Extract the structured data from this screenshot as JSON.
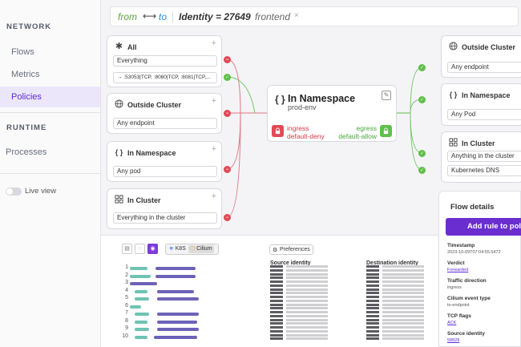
{
  "sidebar": {
    "network_label": "NETWORK",
    "items_network": [
      {
        "label": "Flows"
      },
      {
        "label": "Metrics"
      },
      {
        "label": "Policies"
      }
    ],
    "runtime_label": "RUNTIME",
    "items_runtime": [
      {
        "label": "Processes"
      }
    ],
    "live_view_label": "Live view",
    "live_view_on": false
  },
  "search": {
    "from": "from",
    "arrow": "⟷",
    "to": "to",
    "identity": "Identity = 27649",
    "label": "frontend",
    "close": "×"
  },
  "left_cards": [
    {
      "title": "All",
      "icon": "asterisk-icon",
      "pills": [
        "Everything",
        "→ :53053|TCP, :8080|TCP, :8081|TCP,..."
      ]
    },
    {
      "title": "Outside Cluster",
      "icon": "globe-icon",
      "pills": [
        "Any endpoint"
      ]
    },
    {
      "title": "In Namespace",
      "icon": "braces-icon",
      "pills": [
        "Any pod"
      ]
    },
    {
      "title": "In Cluster",
      "icon": "cluster-icon",
      "pills": [
        "Everything in the cluster"
      ]
    }
  ],
  "center": {
    "braces": "{ }",
    "title": "In Namespace",
    "subtitle": "prod-env",
    "ingress_line1": "ingress",
    "ingress_line2": "default-deny",
    "egress_line1": "egress",
    "egress_line2": "default-allow"
  },
  "right_cards": [
    {
      "title": "Outside Cluster",
      "icon": "globe-icon",
      "pills": [
        "Any endpoint"
      ]
    },
    {
      "title": "In Namespace",
      "icon": "braces-icon",
      "pills": [
        "Any Pod"
      ]
    },
    {
      "title": "In Cluster",
      "icon": "cluster-icon",
      "pills": [
        "Anything in the cluster",
        "Kubernetes DNS"
      ]
    }
  ],
  "bottom": {
    "tags": [
      "K8S",
      "Cilium"
    ],
    "preferences_label": "Preferences",
    "source_identity_header": "Source identity",
    "destination_identity_header": "Destination identity",
    "row_numbers": [
      "1",
      "2",
      "3",
      "4",
      "5",
      "6",
      "7",
      "8",
      "9",
      "10"
    ]
  },
  "flow_details": {
    "title": "Flow details",
    "add_rule_label": "Add rule to poli",
    "fields": [
      {
        "label": "Timestamp",
        "value": "2023-10-09T07:04:55.5472"
      },
      {
        "label": "Verdict",
        "value": "Forwarded"
      },
      {
        "label": "Traffic direction",
        "value": "ingress"
      },
      {
        "label": "Cilium event type",
        "value": "to-endpoint"
      },
      {
        "label": "TCP flags",
        "value": "ACK"
      },
      {
        "label": "Source identity",
        "value": "58828"
      }
    ]
  },
  "colors": {
    "accent": "#5b2bd6",
    "ingress_red": "#e04a56",
    "egress_green": "#5fbf4a"
  }
}
